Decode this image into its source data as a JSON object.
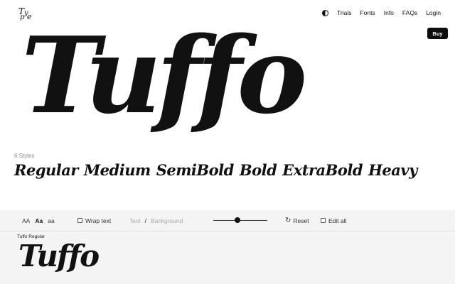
{
  "header": {
    "nav": [
      "Trials",
      "Fonts",
      "Info",
      "FAQs",
      "Login"
    ],
    "buy_label": "Buy"
  },
  "hero": {
    "text": "Tuffo"
  },
  "styles": {
    "count_label": "6 Styles",
    "names": [
      "Regular",
      "Medium",
      "SemiBold",
      "Bold",
      "ExtraBold",
      "Heavy"
    ]
  },
  "toolbar": {
    "case_options": [
      "AA",
      "Aa",
      "aa"
    ],
    "case_selected": "Aa",
    "wrap_text_label": "Wrap text",
    "text_label": "Text",
    "separator": "/",
    "background_label": "Background",
    "size_slider_value": 0.45,
    "reset_label": "Reset",
    "edit_all_label": "Edit all"
  },
  "preview": {
    "style_label": "Tuffo Regular",
    "sample_text": "Tuffo"
  }
}
